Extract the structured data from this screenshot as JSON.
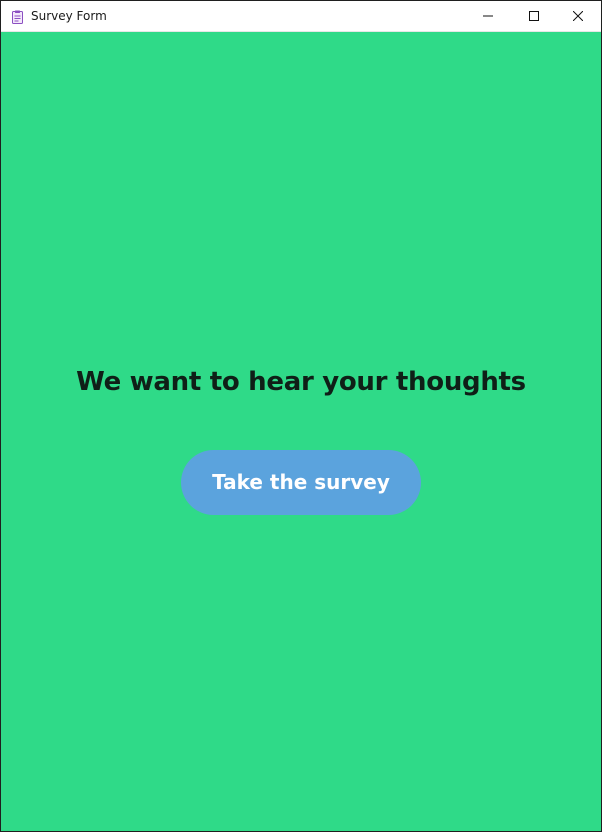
{
  "window": {
    "title": "Survey Form",
    "app_icon": "clipboard-form-icon",
    "controls": [
      "minimize-icon",
      "maximize-icon",
      "close-icon"
    ],
    "background_color": "#2fda88"
  },
  "main": {
    "headline": "We want to hear your thoughts",
    "survey_button_label": "Take the survey",
    "button_color": "#5ba3dd"
  }
}
